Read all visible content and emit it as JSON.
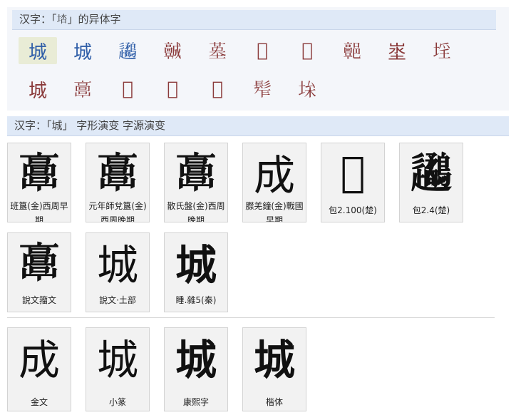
{
  "variants": {
    "header": "汉字：「𡌩」的异体字",
    "row1": [
      "城",
      "城",
      "𨙧",
      "𩫨",
      "𡎸",
      "𨜬",
      "𡊿",
      "𩫩",
      "埊",
      "𡍛"
    ],
    "row2": [
      "城",
      "𩫖",
      "𡋢",
      "𡏕",
      "𡎓",
      "𩬟",
      "𡋠"
    ]
  },
  "evolution": {
    "header": "汉字：「城」 字形演变 字源演变",
    "cards_row1": [
      {
        "glyph": "𩫖",
        "caption": "班簋(金)西周早期"
      },
      {
        "glyph": "𩫖",
        "caption": "元年師兌簋(金)西周晚期"
      },
      {
        "glyph": "𩫖",
        "caption": "散氏盤(金)西周晚期"
      },
      {
        "glyph": "成",
        "caption": "𦡞羌鐘(金)戰國早期"
      },
      {
        "glyph": "𡐼",
        "caption": "包2.100(楚)"
      },
      {
        "glyph": "𨙧",
        "caption": "包2.4(楚)"
      }
    ],
    "cards_row2": [
      {
        "glyph": "𩫖",
        "caption": "說文籀文"
      },
      {
        "glyph": "城",
        "caption": "說文·土部"
      },
      {
        "glyph": "城",
        "caption": "睡.雜5(秦)"
      }
    ],
    "cards_row3": [
      {
        "glyph": "成",
        "caption": "金文"
      },
      {
        "glyph": "城",
        "caption": "小篆"
      },
      {
        "glyph": "城",
        "caption": "康熙字"
      },
      {
        "glyph": "城",
        "caption": "楷体"
      }
    ]
  }
}
